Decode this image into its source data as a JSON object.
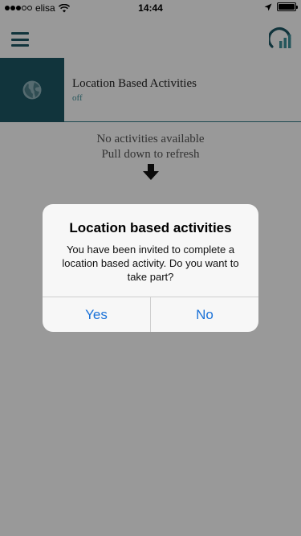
{
  "status_bar": {
    "carrier": "elisa",
    "time": "14:44",
    "battery_level": 1.0
  },
  "nav": {
    "menu_icon": "hamburger-menu-icon",
    "logo_icon": "app-logo-icon"
  },
  "activity": {
    "title": "Location Based Activities",
    "status": "off",
    "icon": "globe-icon"
  },
  "empty_state": {
    "line1": "No activities available",
    "line2": "Pull down to refresh",
    "icon": "down-arrow-icon"
  },
  "dialog": {
    "title": "Location based activities",
    "message": "You have been invited to complete a location based activity. Do you want to take part?",
    "yes_label": "Yes",
    "no_label": "No"
  },
  "colors": {
    "brand_dark": "#1d5765",
    "brand_accent": "#3f8f9a",
    "ios_blue": "#1b72d8"
  }
}
